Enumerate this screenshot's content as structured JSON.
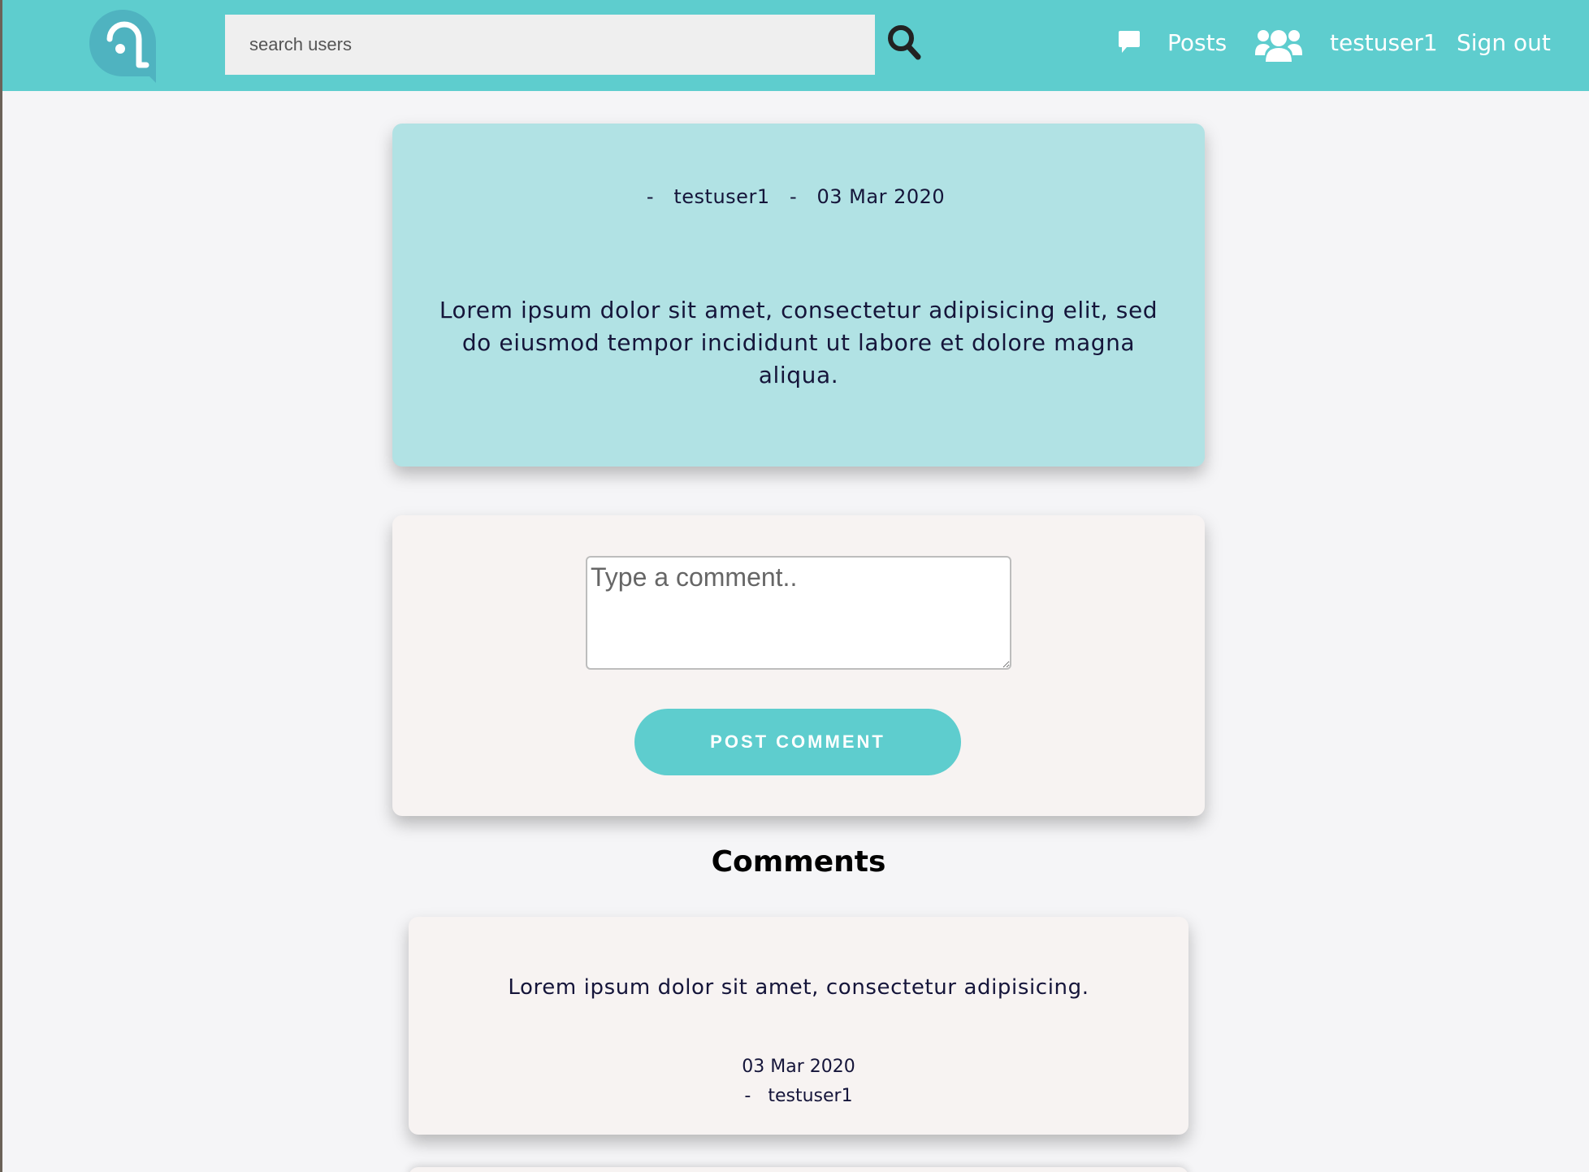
{
  "colors": {
    "accent": "#5ecdce",
    "post_card_bg": "#b1e2e4",
    "card_bg": "#f7f3f2",
    "text_dark": "#15153a"
  },
  "header": {
    "search": {
      "placeholder": "search users",
      "value": ""
    },
    "nav": {
      "posts_label": "Posts",
      "username": "testuser1",
      "signout_label": "Sign out"
    },
    "icons": [
      "app-logo",
      "search-icon",
      "comment-icon",
      "users-icon"
    ]
  },
  "post": {
    "meta": "-   testuser1   -   03 Mar 2020",
    "body": "Lorem ipsum dolor sit amet, consectetur adipisicing elit, sed do eiusmod tempor incididunt ut labore et dolore magna aliqua."
  },
  "comment_form": {
    "placeholder": "Type a comment..",
    "submit_label": "POST COMMENT"
  },
  "comments_section": {
    "heading": "Comments",
    "items": [
      {
        "text": "Lorem ipsum dolor sit amet, consectetur adipisicing.",
        "date": "03 Mar 2020",
        "author": "-   testuser1"
      }
    ]
  }
}
